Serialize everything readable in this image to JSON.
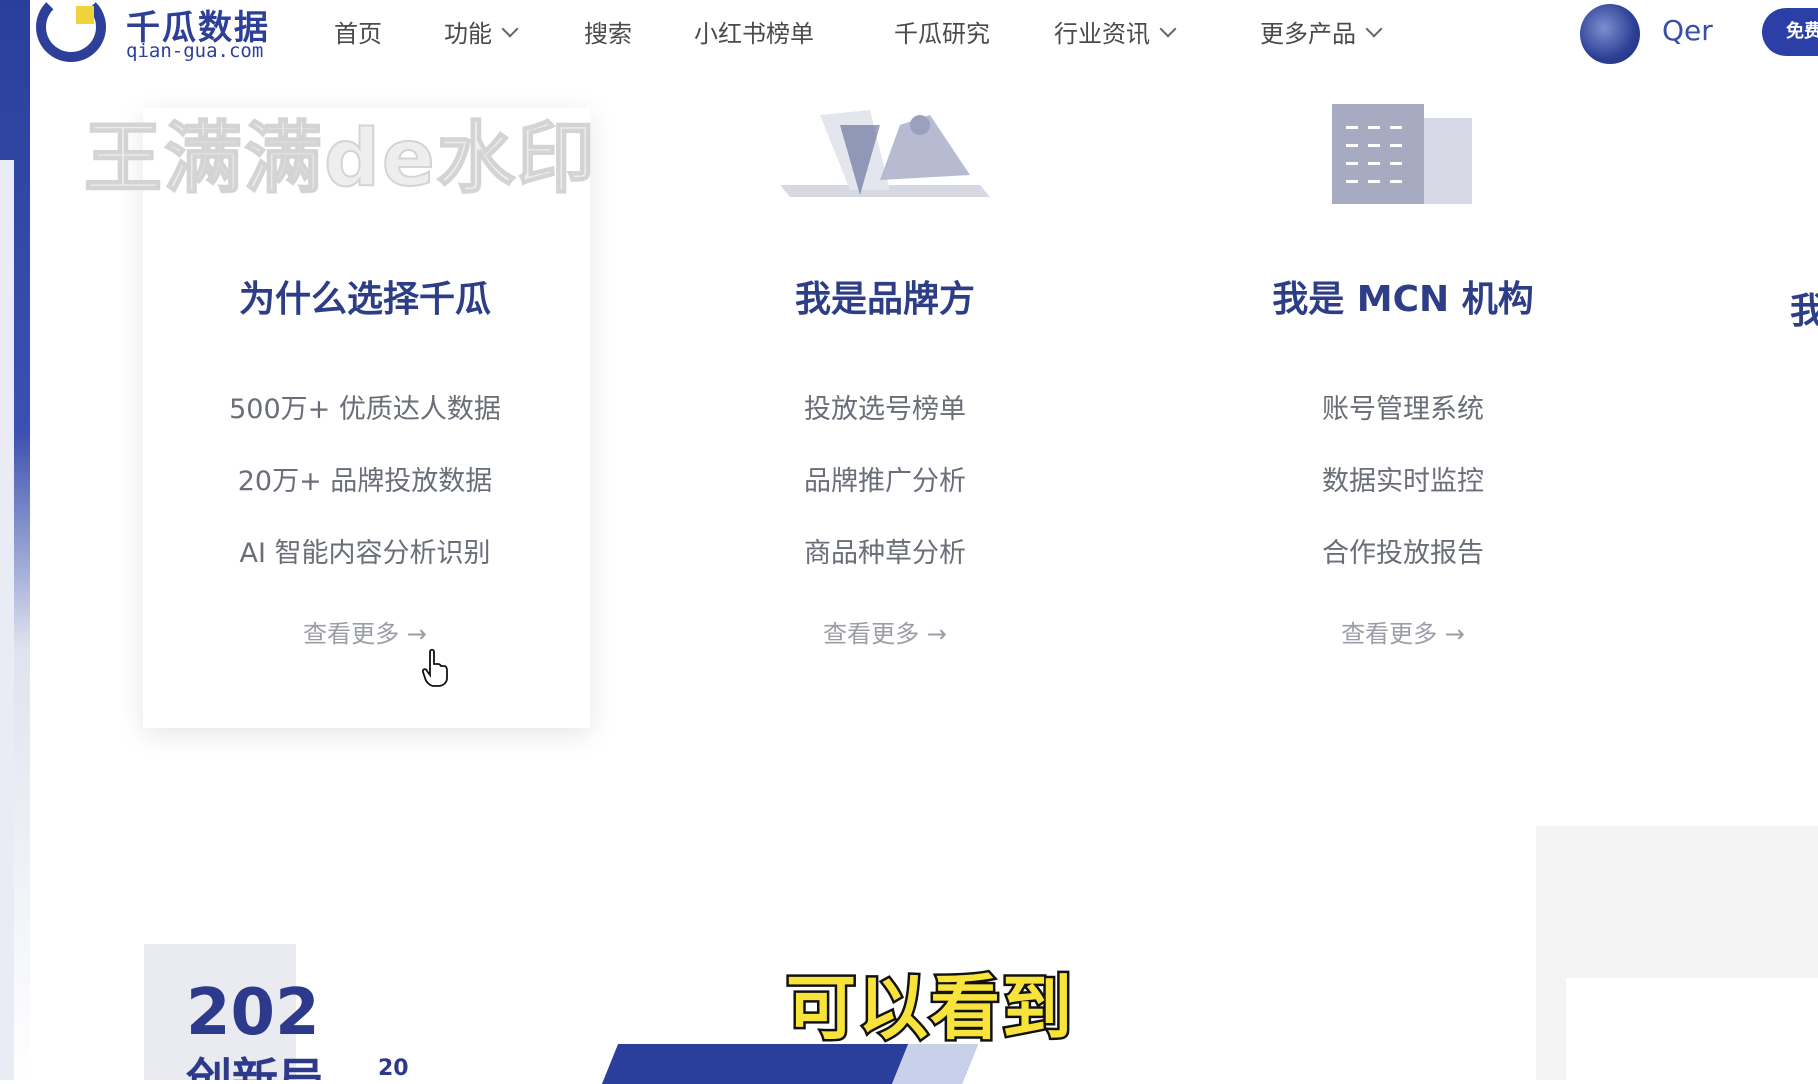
{
  "header": {
    "logo_title": "千瓜数据",
    "logo_url": "qian-gua.com",
    "nav": [
      {
        "label": "首页",
        "dropdown": false
      },
      {
        "label": "功能",
        "dropdown": true
      },
      {
        "label": "搜索",
        "dropdown": false
      },
      {
        "label": "小红书榜单",
        "dropdown": false
      },
      {
        "label": "千瓜研究",
        "dropdown": false
      },
      {
        "label": "行业资讯",
        "dropdown": true
      },
      {
        "label": "更多产品",
        "dropdown": true
      }
    ],
    "user_name": "Qer",
    "free_button": "免费"
  },
  "watermark": "王满满de水印",
  "columns": [
    {
      "title": "为什么选择千瓜",
      "features": [
        "500万+ 优质达人数据",
        "20万+ 品牌投放数据",
        "AI 智能内容分析识别"
      ],
      "more": "查看更多 →"
    },
    {
      "title": "我是品牌方",
      "features": [
        "投放选号榜单",
        "品牌推广分析",
        "商品种草分析"
      ],
      "more": "查看更多 →"
    },
    {
      "title": "我是 MCN 机构",
      "features": [
        "账号管理系统",
        "数据实时监控",
        "合作投放报告"
      ],
      "more": "查看更多 →"
    }
  ],
  "edge_heading": "我",
  "bottom": {
    "year": "202",
    "year_small": "20",
    "cut_text": "创新局"
  },
  "subtitle": "可以看到",
  "colors": {
    "brand_blue": "#2e3f9a",
    "heading_blue": "#2d3e86",
    "logo_yellow": "#f0d23a",
    "subtitle_yellow": "#f7e33a"
  }
}
